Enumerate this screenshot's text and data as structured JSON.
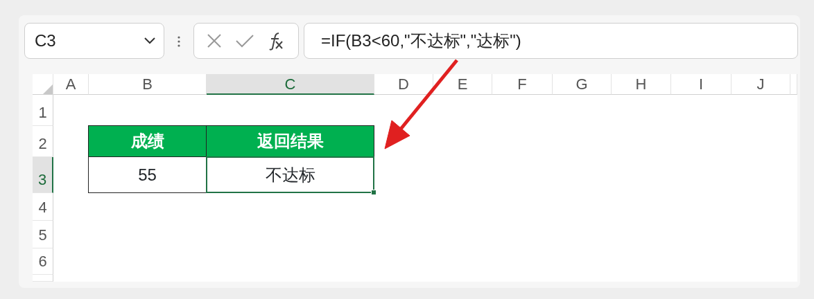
{
  "name_box": {
    "value": "C3"
  },
  "formula_bar": {
    "formula": "=IF(B3<60,\"不达标\",\"达标\")"
  },
  "columns": [
    {
      "label": "A",
      "selected": false
    },
    {
      "label": "B",
      "selected": false
    },
    {
      "label": "C",
      "selected": true
    },
    {
      "label": "D",
      "selected": false
    },
    {
      "label": "E",
      "selected": false
    },
    {
      "label": "F",
      "selected": false
    },
    {
      "label": "G",
      "selected": false
    },
    {
      "label": "H",
      "selected": false
    },
    {
      "label": "I",
      "selected": false
    },
    {
      "label": "J",
      "selected": false
    }
  ],
  "rows": [
    {
      "label": "1",
      "selected": false
    },
    {
      "label": "2",
      "selected": false
    },
    {
      "label": "3",
      "selected": true
    },
    {
      "label": "4",
      "selected": false
    },
    {
      "label": "5",
      "selected": false
    },
    {
      "label": "6",
      "selected": false
    }
  ],
  "table": {
    "header": [
      "成绩",
      "返回结果"
    ],
    "rows": [
      {
        "cells": [
          {
            "text": "55",
            "selected": false
          },
          {
            "text": "不达标",
            "selected": true
          }
        ]
      }
    ]
  }
}
